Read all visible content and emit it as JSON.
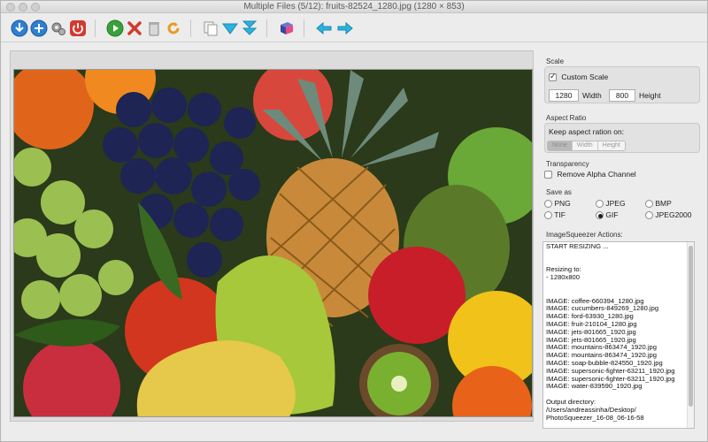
{
  "window": {
    "title": "Multiple Files (5/12): fruits-82524_1280.jpg (1280 × 853)"
  },
  "toolbar": {
    "icons": [
      "download-icon",
      "upload-icon",
      "gears-icon",
      "power-icon",
      "play-icon",
      "cancel-icon",
      "delete-icon",
      "refresh-icon",
      "copy-icon",
      "down-arrow-icon",
      "double-down-arrow-icon",
      "book-icon",
      "back-arrow-icon",
      "forward-arrow-icon"
    ]
  },
  "scale": {
    "section_label": "Scale",
    "custom_scale_label": "Custom Scale",
    "custom_scale_checked": true,
    "width_value": "1280",
    "width_label": "Width",
    "height_value": "800",
    "height_label": "Height"
  },
  "aspect": {
    "section_label": "Aspect Ratio",
    "keep_label": "Keep aspect ration on:",
    "options": [
      "None",
      "Width",
      "Height"
    ],
    "selected": "None"
  },
  "transparency": {
    "section_label": "Transparency",
    "remove_alpha_label": "Remove Alpha Channel",
    "remove_alpha_checked": false
  },
  "saveas": {
    "section_label": "Save as",
    "png": "PNG",
    "jpeg": "JPEG",
    "bmp": "BMP",
    "tif": "TIF",
    "gif": "GIF",
    "jpeg2000": "JPEG2000",
    "selected": "GIF"
  },
  "actions": {
    "section_label": "ImageSqueezer Actions:",
    "log": [
      "START RESIZING ...",
      "",
      "",
      "Resizing to:",
      "- 1280x800",
      "",
      "",
      "IMAGE: coffee-660394_1280.jpg",
      "IMAGE: cucumbers-849269_1280.jpg",
      "IMAGE: ford-63930_1280.jpg",
      "IMAGE: fruit-210104_1280.jpg",
      "IMAGE: jets-801665_1920.jpg",
      "IMAGE: jets-801665_1920.jpg",
      "IMAGE: mountains-863474_1920.jpg",
      "IMAGE: mountains-863474_1920.jpg",
      "IMAGE: soap-bubble-824550_1920.jpg",
      "IMAGE: supersonic-fighter-63211_1920.jpg",
      "IMAGE: supersonic-fighter-63211_1920.jpg",
      "IMAGE: water-839590_1920.jpg",
      "",
      "Output directory:",
      " /Users/andreassinha/Desktop/",
      "PhotoSqueezer_16-08_06-16-58"
    ]
  },
  "colors": {
    "accent_blue": "#2f7fd0",
    "stop_red": "#d23a2e",
    "play_green": "#3aa03a",
    "cyan": "#2bb3e0"
  }
}
